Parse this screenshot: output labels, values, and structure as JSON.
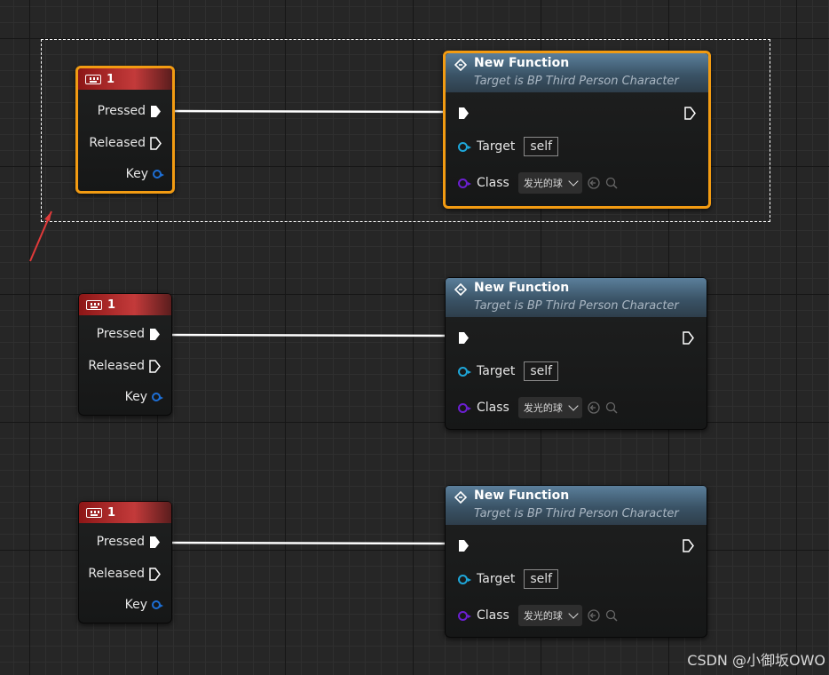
{
  "canvas": {
    "watermark": "CSDN @小御坂OWO"
  },
  "key_nodes": [
    {
      "title": "1",
      "pins": {
        "pressed": "Pressed",
        "released": "Released",
        "key": "Key"
      },
      "selected": true
    },
    {
      "title": "1",
      "pins": {
        "pressed": "Pressed",
        "released": "Released",
        "key": "Key"
      },
      "selected": false
    },
    {
      "title": "1",
      "pins": {
        "pressed": "Pressed",
        "released": "Released",
        "key": "Key"
      },
      "selected": false
    }
  ],
  "function_nodes": [
    {
      "title": "New Function",
      "subtitle": "Target is BP Third Person Character",
      "target_label": "Target",
      "target_value": "self",
      "class_label": "Class",
      "class_value": "发光的球",
      "selected": true
    },
    {
      "title": "New Function",
      "subtitle": "Target is BP Third Person Character",
      "target_label": "Target",
      "target_value": "self",
      "class_label": "Class",
      "class_value": "发光的球",
      "selected": false
    },
    {
      "title": "New Function",
      "subtitle": "Target is BP Third Person Character",
      "target_label": "Target",
      "target_value": "self",
      "class_label": "Class",
      "class_value": "发光的球",
      "selected": false
    }
  ],
  "colors": {
    "selection_outline": "#f29b12",
    "key_header": "#c33a3a",
    "function_header": "#5b7f9b",
    "target_pin": "#1ea6d8",
    "class_pin": "#6b1fd0",
    "key_pin": "#1d6fd6",
    "exec_wire": "#ffffff"
  },
  "icons": {
    "key_event": "keyboard-icon",
    "function": "function-icon",
    "use_selected": "use-selected-asset-icon",
    "browse": "browse-asset-icon"
  }
}
